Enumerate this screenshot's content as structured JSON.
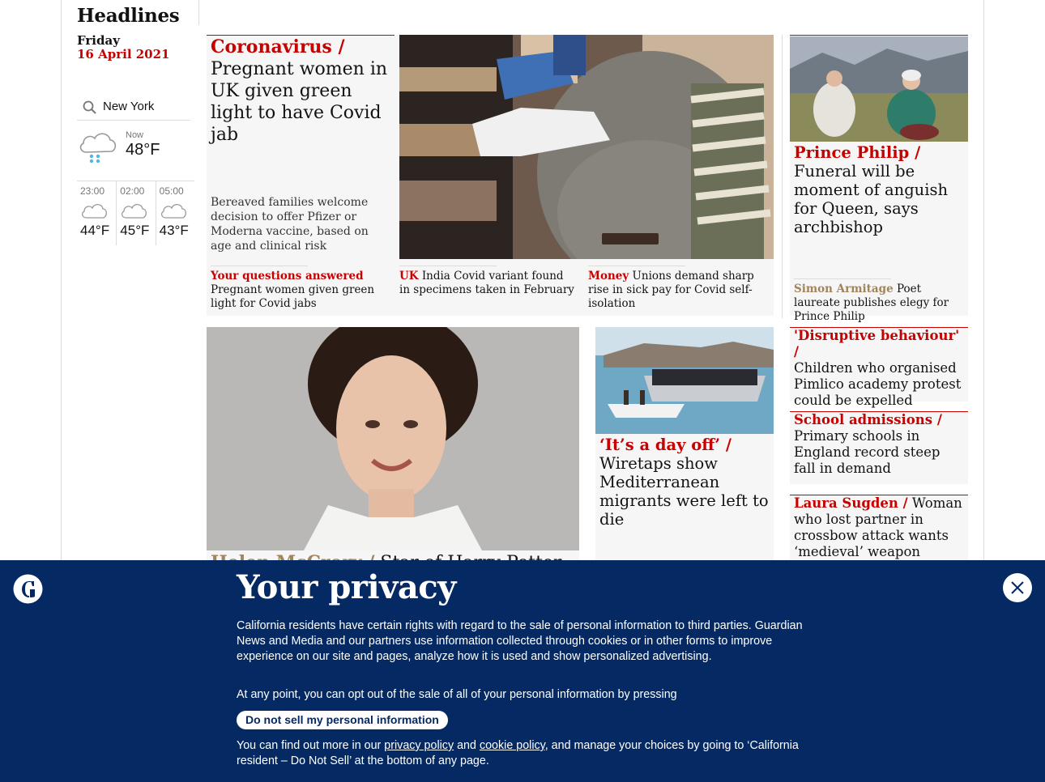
{
  "section": {
    "title": "Headlines",
    "day": "Friday",
    "date": "16 April 2021"
  },
  "weather": {
    "location": "New York",
    "now_label": "Now",
    "now_temp": "48°F",
    "forecast": [
      {
        "time": "23:00",
        "temp": "44°F"
      },
      {
        "time": "02:00",
        "temp": "45°F"
      },
      {
        "time": "05:00",
        "temp": "43°F"
      }
    ]
  },
  "lead": {
    "kicker": "Coronavirus /",
    "headline": "Pregnant women in UK given green light to have Covid jab",
    "standfirst": "Bereaved families welcome decision to offer Pfizer or Moderna vaccine, based on age and clinical risk",
    "sublinks": [
      {
        "kicker": "Your questions answered",
        "text": "Pregnant women given green light for Covid jabs"
      },
      {
        "kicker": "UK",
        "text": "India Covid variant found in specimens taken in February"
      },
      {
        "kicker": "Money",
        "text": "Unions demand sharp rise in sick pay for Covid self-isolation"
      }
    ]
  },
  "philip": {
    "kicker": "Prince Philip /",
    "headline": "Funeral will be moment of anguish for Queen, says archbishop",
    "sub_kicker": "Simon Armitage",
    "sub_text": "Poet laureate publishes elegy for Prince Philip"
  },
  "mccrory": {
    "kicker": "Helen McCrory /",
    "headline": "Star of Harry Potter and"
  },
  "migrants": {
    "kicker": "‘It’s a day off’ /",
    "headline": "Wiretaps show Mediterranean migrants were left to die"
  },
  "stack": [
    {
      "kicker": "'Disruptive behaviour' /",
      "headline": "Children who organised Pimlico academy protest could be expelled"
    },
    {
      "kicker": "School admissions /",
      "headline": "Primary schools in England record steep fall in demand"
    },
    {
      "kicker": "Laura Sugden /",
      "headline": "Woman who lost partner in crossbow attack wants ‘medieval’ weapon"
    }
  ],
  "privacy": {
    "title": "Your privacy",
    "p1": "California residents have certain rights with regard to the sale of personal information to third parties. Guardian News and Media and our partners use information collected through cookies or in other forms to improve experience on our site and pages, analyze how it is used and show personalized advertising.",
    "p2": "At any point, you can opt out of the sale of all of your personal information by pressing",
    "button": "Do not sell my personal information",
    "p3_a": "You can find out more in our",
    "link1": "privacy policy",
    "p3_b": "and",
    "link2": "cookie policy",
    "p3_c": ", and manage your choices by going to ‘California resident – Do Not Sell’ at the bottom of any page."
  },
  "colors": {
    "brand_red": "#c70000",
    "privacy_bg": "#052962",
    "gold": "#a1845c"
  },
  "icons": [
    "search-icon",
    "rain-cloud-icon",
    "cloud-icon",
    "guardian-logo-icon",
    "close-icon"
  ]
}
